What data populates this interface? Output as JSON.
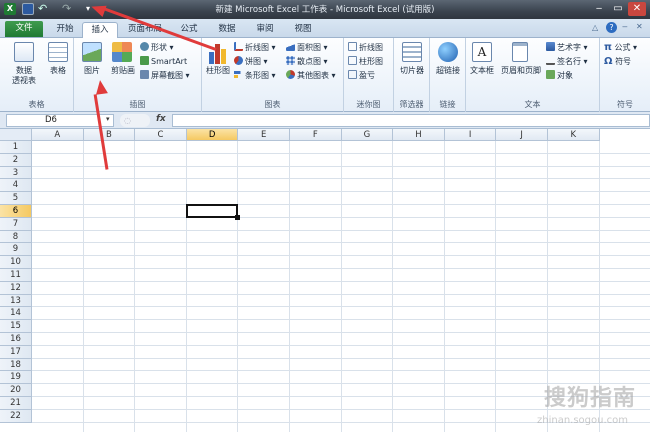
{
  "window": {
    "title": "新建 Microsoft Excel 工作表 - Microsoft Excel (试用版)"
  },
  "tabs": [
    {
      "label": "文件"
    },
    {
      "label": "开始"
    },
    {
      "label": "插入"
    },
    {
      "label": "页面布局"
    },
    {
      "label": "公式"
    },
    {
      "label": "数据"
    },
    {
      "label": "审阅"
    },
    {
      "label": "视图"
    }
  ],
  "ribbon": {
    "tables": {
      "label": "表格",
      "pivot": "数据\n透视表",
      "table": "表格"
    },
    "illustrations": {
      "label": "插图",
      "picture": "图片",
      "clipart": "剪贴画",
      "shapes": "形状",
      "smartart": "SmartArt",
      "screenshot": "屏幕截图"
    },
    "charts": {
      "label": "图表",
      "column": "柱形图",
      "line": "折线图",
      "pie": "饼图",
      "bar": "条形图",
      "area": "面积图",
      "scatter": "散点图",
      "other": "其他图表"
    },
    "sparklines": {
      "label": "迷你图",
      "line": "折线图",
      "column": "柱形图",
      "winloss": "盈亏"
    },
    "filter": {
      "label": "筛选器",
      "slicer": "切片器"
    },
    "links": {
      "label": "链接",
      "hyperlink": "超链接"
    },
    "text": {
      "label": "文本",
      "textbox": "文本框",
      "header": "页眉和页脚",
      "wordart": "艺术字",
      "signature": "签名行",
      "object": "对象"
    },
    "symbols": {
      "label": "符号",
      "equation": "公式",
      "symbol": "符号",
      "pi": "π",
      "omega": "Ω"
    }
  },
  "formula_bar": {
    "name_box": "D6",
    "fx": "fx",
    "value": ""
  },
  "columns": [
    "A",
    "B",
    "C",
    "D",
    "E",
    "F",
    "G",
    "H",
    "I",
    "J",
    "K"
  ],
  "rows": [
    "1",
    "2",
    "3",
    "4",
    "5",
    "6",
    "7",
    "8",
    "9",
    "10",
    "11",
    "12",
    "13",
    "14",
    "15",
    "16",
    "17",
    "18",
    "19",
    "20",
    "21",
    "22"
  ],
  "selection": {
    "cell": "D6",
    "column": "D",
    "row": "6"
  },
  "watermark": {
    "text": "搜狗指南",
    "url": "zhinan.sogou.com"
  },
  "colors": {
    "file_tab": "#1f7a33",
    "selection_header": "#f5c962",
    "annotation_arrow": "#e03b3b"
  }
}
